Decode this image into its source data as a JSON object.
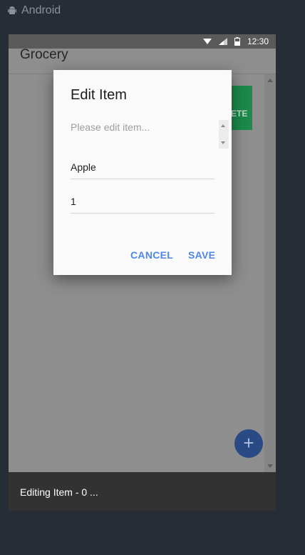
{
  "window": {
    "label": "Android",
    "icon": "android-icon"
  },
  "statusbar": {
    "time": "12:30",
    "icons": [
      "wifi-icon",
      "signal-icon",
      "battery-icon"
    ]
  },
  "appbar": {
    "title": "Grocery"
  },
  "background_button": {
    "label": "ETE",
    "color": "#1b8a4a"
  },
  "fab": {
    "label": "+",
    "icon": "plus-icon",
    "color": "#2a4a86"
  },
  "snackbar": {
    "text": "Editing Item - 0 ..."
  },
  "dialog": {
    "title": "Edit Item",
    "hint": "Please edit item...",
    "name_value": "Apple",
    "quantity_value": "1",
    "cancel_label": "CANCEL",
    "save_label": "SAVE",
    "accent": "#4f86e8"
  }
}
